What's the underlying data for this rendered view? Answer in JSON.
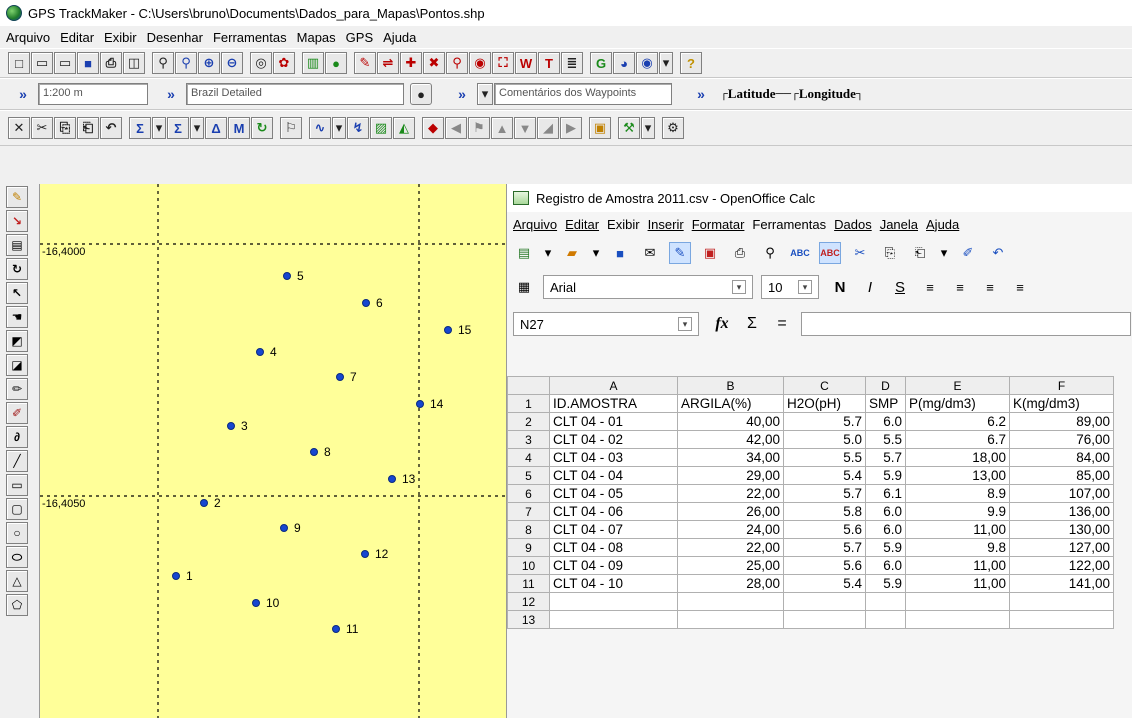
{
  "gtm": {
    "title": "GPS TrackMaker - C:\\Users\\bruno\\Documents\\Dados_para_Mapas\\Pontos.shp",
    "menu": [
      "Arquivo",
      "Editar",
      "Exibir",
      "Desenhar",
      "Ferramentas",
      "Mapas",
      "GPS",
      "Ajuda"
    ],
    "scale_value": "1:200 m",
    "map_name": "Brazil Detailed",
    "comment_field": "Comentários dos Waypoints",
    "latitude_label": "Latitude",
    "longitude_label": "Longitude",
    "grid_labels": [
      "-16,4000",
      "-16,4050"
    ],
    "waypoints": [
      {
        "id": "1"
      },
      {
        "id": "2"
      },
      {
        "id": "3"
      },
      {
        "id": "4"
      },
      {
        "id": "5"
      },
      {
        "id": "6"
      },
      {
        "id": "7"
      },
      {
        "id": "8"
      },
      {
        "id": "9"
      },
      {
        "id": "10"
      },
      {
        "id": "11"
      },
      {
        "id": "12"
      },
      {
        "id": "13"
      },
      {
        "id": "14"
      },
      {
        "id": "15"
      }
    ]
  },
  "calc": {
    "title": "Registro de Amostra 2011.csv - OpenOffice Calc",
    "menu": [
      "Arquivo",
      "Editar",
      "Exibir",
      "Inserir",
      "Formatar",
      "Ferramentas",
      "Dados",
      "Janela",
      "Ajuda"
    ],
    "font_name": "Arial",
    "font_size": "10",
    "name_box": "N27",
    "fx_label": "fx",
    "sum_label": "Σ",
    "eq_label": "=",
    "bold_label": "N",
    "italic_label": "I",
    "underline_label": "S",
    "columns": [
      "A",
      "B",
      "C",
      "D",
      "E",
      "F"
    ],
    "rows": [
      {
        "n": "1",
        "cells": [
          "ID.AMOSTRA",
          "ARGILA(%)",
          "H2O(pH)",
          "SMP",
          "P(mg/dm3)",
          "K(mg/dm3)"
        ]
      },
      {
        "n": "2",
        "cells": [
          "CLT 04 - 01",
          "40,00",
          "5.7",
          "6.0",
          "6.2",
          "89,00"
        ]
      },
      {
        "n": "3",
        "cells": [
          "CLT 04 - 02",
          "42,00",
          "5.0",
          "5.5",
          "6.7",
          "76,00"
        ]
      },
      {
        "n": "4",
        "cells": [
          "CLT 04 - 03",
          "34,00",
          "5.5",
          "5.7",
          "18,00",
          "84,00"
        ]
      },
      {
        "n": "5",
        "cells": [
          "CLT 04 - 04",
          "29,00",
          "5.4",
          "5.9",
          "13,00",
          "85,00"
        ]
      },
      {
        "n": "6",
        "cells": [
          "CLT 04 - 05",
          "22,00",
          "5.7",
          "6.1",
          "8.9",
          "107,00"
        ]
      },
      {
        "n": "7",
        "cells": [
          "CLT 04 - 06",
          "26,00",
          "5.8",
          "6.0",
          "9.9",
          "136,00"
        ]
      },
      {
        "n": "8",
        "cells": [
          "CLT 04 - 07",
          "24,00",
          "5.6",
          "6.0",
          "11,00",
          "130,00"
        ]
      },
      {
        "n": "9",
        "cells": [
          "CLT 04 - 08",
          "22,00",
          "5.7",
          "5.9",
          "9.8",
          "127,00"
        ]
      },
      {
        "n": "10",
        "cells": [
          "CLT 04 - 09",
          "25,00",
          "5.6",
          "6.0",
          "11,00",
          "122,00"
        ]
      },
      {
        "n": "11",
        "cells": [
          "CLT 04 - 10",
          "28,00",
          "5.4",
          "5.9",
          "11,00",
          "141,00"
        ]
      },
      {
        "n": "12",
        "cells": [
          "",
          "",
          "",
          "",
          "",
          ""
        ]
      },
      {
        "n": "13",
        "cells": [
          "",
          "",
          "",
          "",
          "",
          ""
        ]
      }
    ]
  }
}
